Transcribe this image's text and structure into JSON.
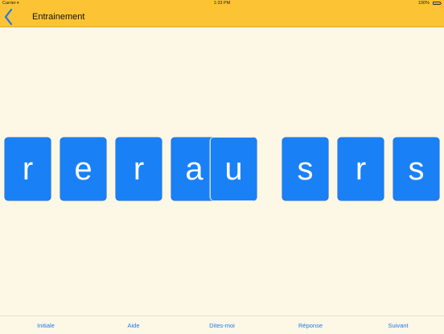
{
  "status": {
    "carrier": "Carrier",
    "wifi_icon": "wifi-icon",
    "time": "1:33 PM",
    "battery": "100%"
  },
  "navbar": {
    "title": "Entrainement",
    "back_icon": "chevron-left-icon",
    "background": "#fcc334"
  },
  "tiles": [
    "r",
    "e",
    "r",
    "a",
    "u",
    "s",
    "r",
    "s"
  ],
  "tile_color": "#1a80f5",
  "toolbar": {
    "initiale": "Initiale",
    "aide": "Aide",
    "dites_moi": "Dites-moi",
    "reponse": "Réponse",
    "suivant": "Suivant"
  }
}
